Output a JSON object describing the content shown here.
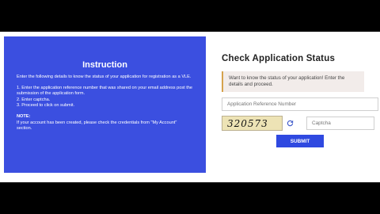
{
  "instruction": {
    "title": "Instruction",
    "intro": "Enter the following details to know the status of your application for registration as a VLE.",
    "steps": [
      "1. Enter the application reference number that was shared on your email address post the submission of the application form.",
      "2. Enter captcha.",
      "3. Proceed to click on submit."
    ],
    "note_label": "NOTE:",
    "note_text": "If your account has been created, please check the credentials from \"My Account\" section."
  },
  "status": {
    "title": "Check Application Status",
    "alert": "Want to know the status of your application! Enter the details and proceed.",
    "reference_placeholder": "Application Reference Number",
    "captcha_text": "320573",
    "captcha_placeholder": "Captcha",
    "submit_label": "SUBMIT"
  },
  "colors": {
    "instruction_bg": "#3b4fe0",
    "submit_bg": "#2f49e0",
    "alert_border": "#d5a24c",
    "captcha_bg": "#ede3b5"
  },
  "icons": {
    "refresh": "refresh-icon"
  }
}
